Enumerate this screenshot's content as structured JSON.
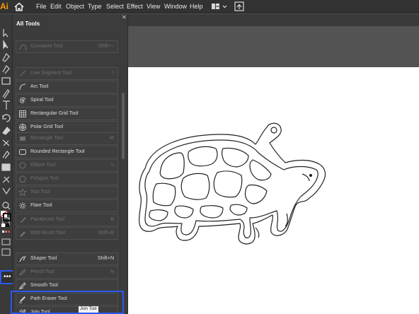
{
  "app": {
    "logo": "Ai"
  },
  "menu": {
    "items": [
      "File",
      "Edit",
      "Object",
      "Type",
      "Select",
      "Effect",
      "View",
      "Window",
      "Help"
    ]
  },
  "drawer": {
    "title": "All Tools",
    "groups": [
      [
        {
          "label": "Curvature Tool",
          "shortcut": "Shift+~",
          "icon": "curvature-icon",
          "disabled": true
        }
      ],
      [
        {
          "label": "Line Segment Tool",
          "shortcut": "\\",
          "icon": "line-segment-icon",
          "disabled": true
        },
        {
          "label": "Arc Tool",
          "shortcut": "",
          "icon": "arc-icon",
          "disabled": false
        },
        {
          "label": "Spiral Tool",
          "shortcut": "",
          "icon": "spiral-icon",
          "disabled": false
        },
        {
          "label": "Rectangular Grid Tool",
          "shortcut": "",
          "icon": "rectangular-grid-icon",
          "disabled": false
        },
        {
          "label": "Polar Grid Tool",
          "shortcut": "",
          "icon": "polar-grid-icon",
          "disabled": false
        }
      ],
      [
        {
          "label": "Rectangle Tool",
          "shortcut": "M",
          "icon": "rectangle-icon",
          "disabled": true
        },
        {
          "label": "Rounded Rectangle Tool",
          "shortcut": "",
          "icon": "rounded-rectangle-icon",
          "disabled": false
        },
        {
          "label": "Ellipse Tool",
          "shortcut": "L",
          "icon": "ellipse-icon",
          "disabled": true
        },
        {
          "label": "Polygon Tool",
          "shortcut": "",
          "icon": "polygon-icon",
          "disabled": true
        },
        {
          "label": "Star Tool",
          "shortcut": "",
          "icon": "star-icon",
          "disabled": true
        },
        {
          "label": "Flare Tool",
          "shortcut": "",
          "icon": "flare-icon",
          "disabled": false
        }
      ],
      [
        {
          "label": "Paintbrush Tool",
          "shortcut": "B",
          "icon": "paintbrush-icon",
          "disabled": true
        },
        {
          "label": "Blob Brush Tool",
          "shortcut": "Shift+B",
          "icon": "blob-brush-icon",
          "disabled": true
        }
      ],
      [
        {
          "label": "Shaper Tool",
          "shortcut": "Shift+N",
          "icon": "shaper-icon",
          "disabled": false
        },
        {
          "label": "Pencil Tool",
          "shortcut": "N",
          "icon": "pencil-icon",
          "disabled": true
        },
        {
          "label": "Smooth Tool",
          "shortcut": "",
          "icon": "smooth-icon",
          "disabled": false
        },
        {
          "label": "Path Eraser Tool",
          "shortcut": "",
          "icon": "path-eraser-icon",
          "disabled": false
        },
        {
          "label": "Join Tool",
          "shortcut": "",
          "icon": "join-icon",
          "disabled": false
        }
      ]
    ],
    "tooltip": "Join Tool"
  },
  "toolbar": {
    "more_tools": "•••"
  },
  "colors": {
    "highlight": "#2b59f0",
    "logo": "#ff9a00"
  }
}
